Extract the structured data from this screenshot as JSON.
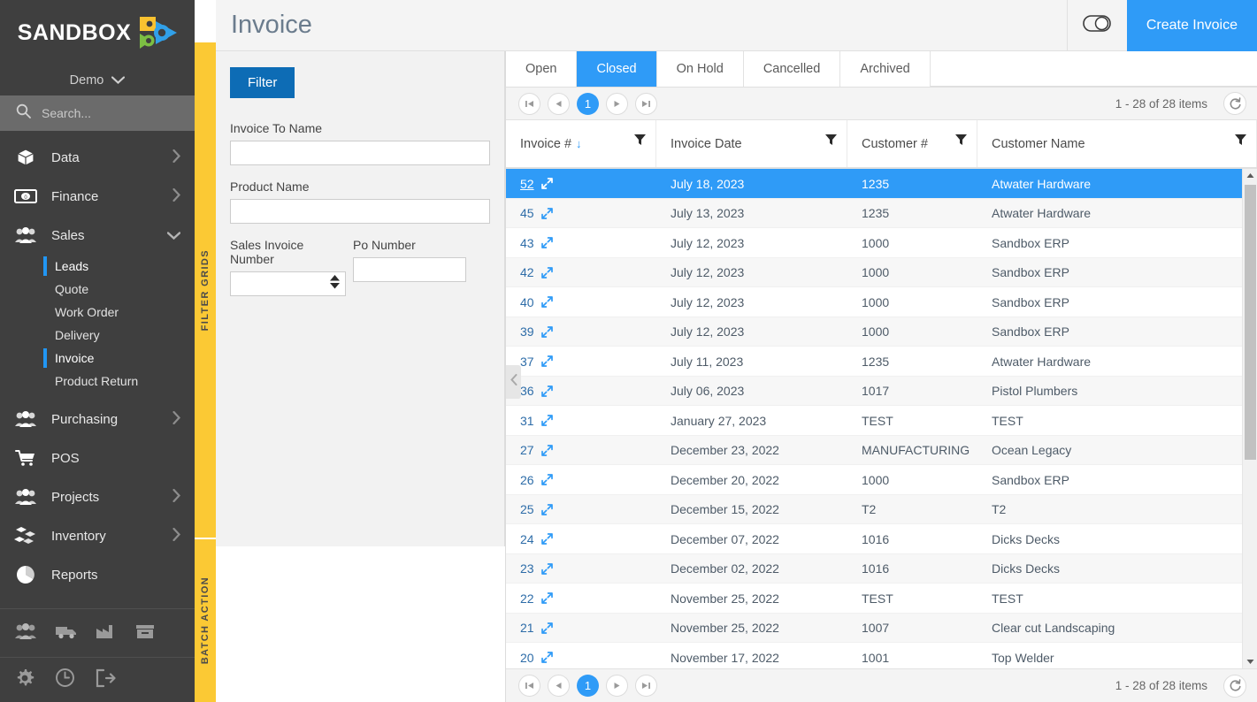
{
  "sidebar": {
    "logo_text": "SANDBOX",
    "logo_icon": "sandbox-gears-play-logo",
    "tenant": "Demo",
    "tenant_chevron_icon": "chevron-down-icon",
    "search_placeholder": "Search...",
    "search_icon": "search-icon",
    "nav": [
      {
        "label": "Data",
        "icon": "box-icon",
        "arrow": "chevron-right-icon"
      },
      {
        "label": "Finance",
        "icon": "banknote-icon",
        "arrow": "chevron-right-icon"
      },
      {
        "label": "Sales",
        "icon": "people-icon",
        "arrow": "chevron-down-icon"
      },
      {
        "label": "Purchasing",
        "icon": "people-icon",
        "arrow": "chevron-right-icon"
      },
      {
        "label": "POS",
        "icon": "cart-icon",
        "arrow": ""
      },
      {
        "label": "Projects",
        "icon": "people-icon",
        "arrow": "chevron-right-icon"
      },
      {
        "label": "Inventory",
        "icon": "cubes-icon",
        "arrow": "chevron-right-icon"
      },
      {
        "label": "Reports",
        "icon": "pie-chart-icon",
        "arrow": ""
      }
    ],
    "sales_sub": [
      {
        "label": "Leads",
        "active": false
      },
      {
        "label": "Quote",
        "active": false
      },
      {
        "label": "Work Order",
        "active": false
      },
      {
        "label": "Delivery",
        "active": false
      },
      {
        "label": "Invoice",
        "active": true
      },
      {
        "label": "Product Return",
        "active": false
      }
    ],
    "quick_icons": [
      "people-icon",
      "truck-icon",
      "factory-icon",
      "archive-icon"
    ],
    "footer_icons": [
      "gear-icon",
      "clock-icon",
      "logout-icon"
    ]
  },
  "rails": {
    "filter_grids": "FILTER GRIDS",
    "batch_action": "BATCH ACTION"
  },
  "header": {
    "title": "Invoice",
    "toggle_icon": "toggle-switch-icon",
    "create_label": "Create Invoice"
  },
  "filter_panel": {
    "filter_button": "Filter",
    "fields": [
      {
        "label": "Invoice To Name",
        "value": "",
        "placeholder": ""
      },
      {
        "label": "Product Name",
        "value": "",
        "placeholder": ""
      },
      {
        "label": "Sales Invoice Number",
        "value": "",
        "placeholder": ""
      },
      {
        "label": "Po Number",
        "value": "",
        "placeholder": ""
      }
    ],
    "collapse_icon": "chevron-left-icon"
  },
  "grid": {
    "tabs": [
      {
        "label": "Open",
        "active": false
      },
      {
        "label": "Closed",
        "active": true
      },
      {
        "label": "On Hold",
        "active": false
      },
      {
        "label": "Cancelled",
        "active": false
      },
      {
        "label": "Archived",
        "active": false
      }
    ],
    "pager": {
      "first_icon": "page-first-icon",
      "prev_icon": "page-prev-icon",
      "current_page": "1",
      "next_icon": "page-next-icon",
      "last_icon": "page-last-icon",
      "count_text": "1 - 28 of 28 items",
      "refresh_icon": "refresh-icon"
    },
    "columns": [
      {
        "label": "Invoice #",
        "sort": "desc",
        "filter_icon": "funnel-icon"
      },
      {
        "label": "Invoice Date",
        "sort": "",
        "filter_icon": "funnel-icon"
      },
      {
        "label": "Customer #",
        "sort": "",
        "filter_icon": "funnel-icon"
      },
      {
        "label": "Customer Name",
        "sort": "",
        "filter_icon": "funnel-icon"
      }
    ],
    "expand_icon": "expand-arrows-icon",
    "rows": [
      {
        "invoice": "52",
        "date": "July 18, 2023",
        "customer_no": "1235",
        "customer_name": "Atwater Hardware",
        "selected": true
      },
      {
        "invoice": "45",
        "date": "July 13, 2023",
        "customer_no": "1235",
        "customer_name": "Atwater Hardware",
        "selected": false
      },
      {
        "invoice": "43",
        "date": "July 12, 2023",
        "customer_no": "1000",
        "customer_name": "Sandbox ERP",
        "selected": false
      },
      {
        "invoice": "42",
        "date": "July 12, 2023",
        "customer_no": "1000",
        "customer_name": "Sandbox ERP",
        "selected": false
      },
      {
        "invoice": "40",
        "date": "July 12, 2023",
        "customer_no": "1000",
        "customer_name": "Sandbox ERP",
        "selected": false
      },
      {
        "invoice": "39",
        "date": "July 12, 2023",
        "customer_no": "1000",
        "customer_name": "Sandbox ERP",
        "selected": false
      },
      {
        "invoice": "37",
        "date": "July 11, 2023",
        "customer_no": "1235",
        "customer_name": "Atwater Hardware",
        "selected": false
      },
      {
        "invoice": "36",
        "date": "July 06, 2023",
        "customer_no": "1017",
        "customer_name": "Pistol Plumbers",
        "selected": false
      },
      {
        "invoice": "31",
        "date": "January 27, 2023",
        "customer_no": "TEST",
        "customer_name": "TEST",
        "selected": false
      },
      {
        "invoice": "27",
        "date": "December 23, 2022",
        "customer_no": "MANUFACTURING",
        "customer_name": "Ocean Legacy",
        "selected": false
      },
      {
        "invoice": "26",
        "date": "December 20, 2022",
        "customer_no": "1000",
        "customer_name": "Sandbox ERP",
        "selected": false
      },
      {
        "invoice": "25",
        "date": "December 15, 2022",
        "customer_no": "T2",
        "customer_name": "T2",
        "selected": false
      },
      {
        "invoice": "24",
        "date": "December 07, 2022",
        "customer_no": "1016",
        "customer_name": "Dicks Decks",
        "selected": false
      },
      {
        "invoice": "23",
        "date": "December 02, 2022",
        "customer_no": "1016",
        "customer_name": "Dicks Decks",
        "selected": false
      },
      {
        "invoice": "22",
        "date": "November 25, 2022",
        "customer_no": "TEST",
        "customer_name": "TEST",
        "selected": false
      },
      {
        "invoice": "21",
        "date": "November 25, 2022",
        "customer_no": "1007",
        "customer_name": "Clear cut Landscaping",
        "selected": false
      },
      {
        "invoice": "20",
        "date": "November 17, 2022",
        "customer_no": "1001",
        "customer_name": "Top Welder",
        "selected": false
      }
    ]
  },
  "colors": {
    "accent_blue": "#2f9bf7",
    "filter_blue": "#0d6cb5",
    "rail_yellow": "#fbc934",
    "sidebar_dark": "#3f3f3f"
  }
}
